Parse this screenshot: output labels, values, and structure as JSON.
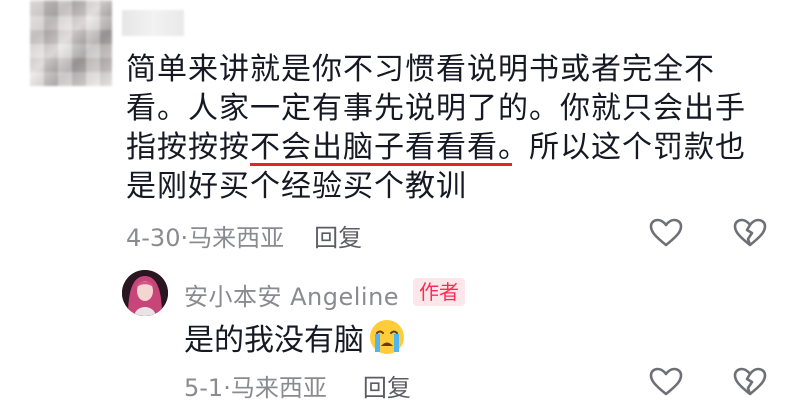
{
  "comment": {
    "line1": "简单来讲就是你不习惯看说明书或者完全不",
    "line2": "看。人家一定有事先说明了的。你就只会出手",
    "line3_plain": "指按按按",
    "line3_underlined": "不会出脑子看看看。",
    "line3_rest": "所以这个罚款也",
    "line4": "是刚好买个经验买个教训",
    "meta": "4-30·马来西亚",
    "reply_label": "回复"
  },
  "reply": {
    "author": "安小本安 Angeline",
    "badge": "作者",
    "text": "是的我没有脑",
    "meta": "5-1·马来西亚",
    "reply_label": "回复"
  },
  "icons": [
    "heart-icon",
    "broken-heart-icon",
    "crying-face-emoji"
  ],
  "colors": {
    "text": "#161823",
    "meta": "#8a8b91",
    "badge": "#fe2c55",
    "underline": "#e0281f"
  }
}
